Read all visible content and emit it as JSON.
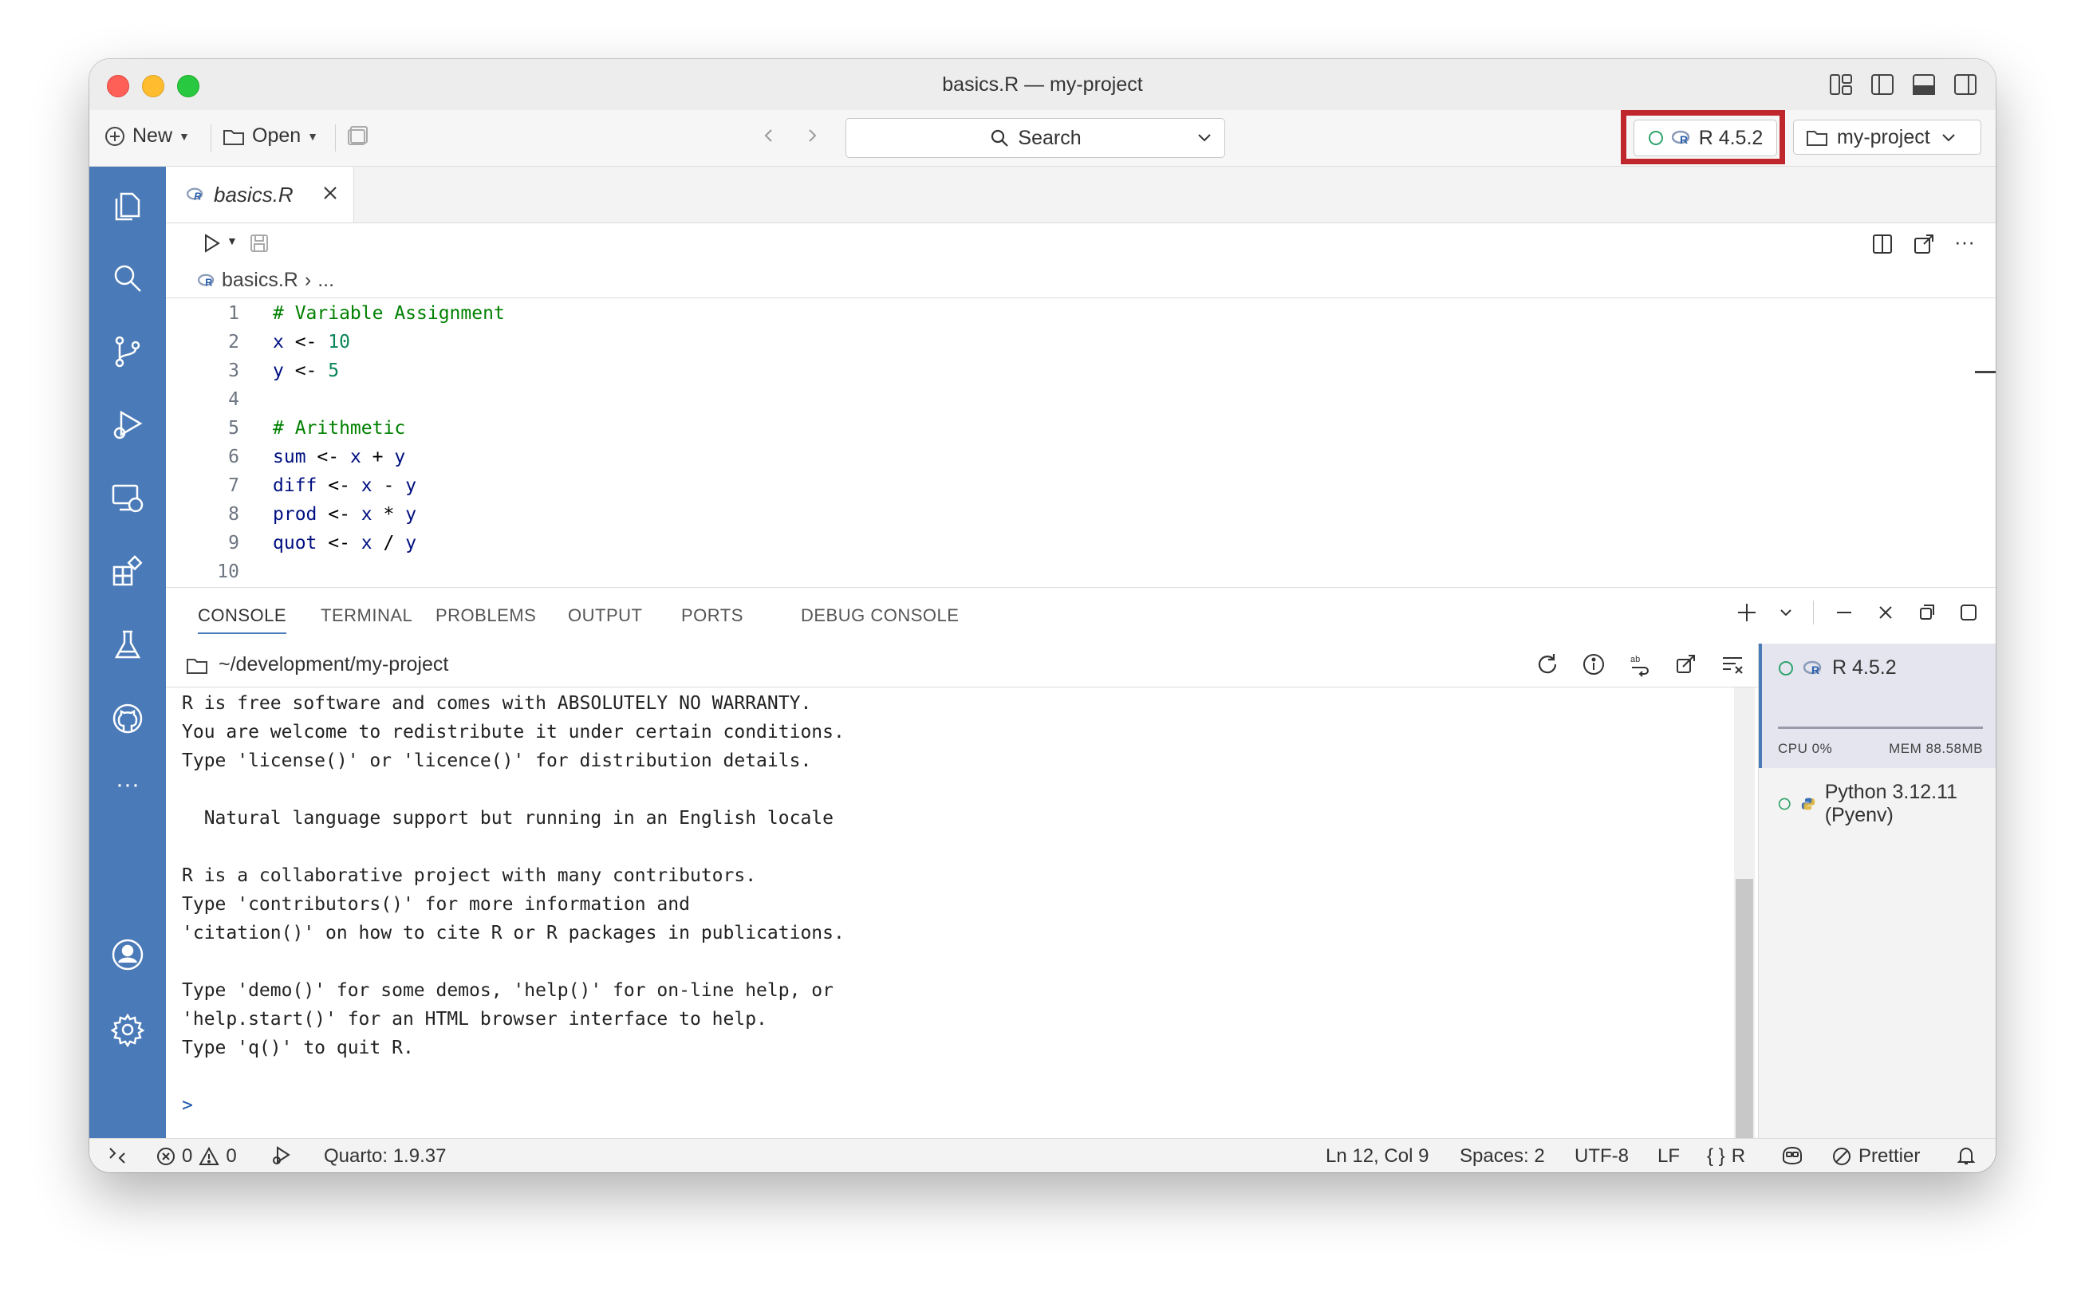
{
  "window": {
    "title": "basics.R — my-project"
  },
  "toolbar": {
    "new_label": "New",
    "open_label": "Open",
    "search_label": "Search",
    "interpreter_label": "R 4.5.2",
    "project_label": "my-project"
  },
  "editor": {
    "tab_label": "basics.R",
    "breadcrumb_file": "basics.R",
    "breadcrumb_more": "...",
    "lines": [
      {
        "n": "1",
        "tokens": [
          {
            "t": "# Variable Assignment",
            "c": "c-com"
          }
        ]
      },
      {
        "n": "2",
        "tokens": [
          {
            "t": "x",
            "c": "c-id"
          },
          {
            "t": " <- ",
            "c": "c-op"
          },
          {
            "t": "10",
            "c": "c-num"
          }
        ]
      },
      {
        "n": "3",
        "tokens": [
          {
            "t": "y",
            "c": "c-id"
          },
          {
            "t": " <- ",
            "c": "c-op"
          },
          {
            "t": "5",
            "c": "c-num"
          }
        ]
      },
      {
        "n": "4",
        "tokens": []
      },
      {
        "n": "5",
        "tokens": [
          {
            "t": "# Arithmetic",
            "c": "c-com"
          }
        ]
      },
      {
        "n": "6",
        "tokens": [
          {
            "t": "sum",
            "c": "c-id"
          },
          {
            "t": " <- ",
            "c": "c-op"
          },
          {
            "t": "x",
            "c": "c-id"
          },
          {
            "t": " + ",
            "c": "c-op"
          },
          {
            "t": "y",
            "c": "c-id"
          }
        ]
      },
      {
        "n": "7",
        "tokens": [
          {
            "t": "diff",
            "c": "c-id"
          },
          {
            "t": " <- ",
            "c": "c-op"
          },
          {
            "t": "x",
            "c": "c-id"
          },
          {
            "t": " - ",
            "c": "c-op"
          },
          {
            "t": "y",
            "c": "c-id"
          }
        ]
      },
      {
        "n": "8",
        "tokens": [
          {
            "t": "prod",
            "c": "c-id"
          },
          {
            "t": " <- ",
            "c": "c-op"
          },
          {
            "t": "x",
            "c": "c-id"
          },
          {
            "t": " * ",
            "c": "c-op"
          },
          {
            "t": "y",
            "c": "c-id"
          }
        ]
      },
      {
        "n": "9",
        "tokens": [
          {
            "t": "quot",
            "c": "c-id"
          },
          {
            "t": " <- ",
            "c": "c-op"
          },
          {
            "t": "x",
            "c": "c-id"
          },
          {
            "t": " / ",
            "c": "c-op"
          },
          {
            "t": "y",
            "c": "c-id"
          }
        ]
      },
      {
        "n": "10",
        "tokens": []
      }
    ]
  },
  "panel": {
    "tabs": [
      "CONSOLE",
      "TERMINAL",
      "PROBLEMS",
      "OUTPUT",
      "PORTS",
      "DEBUG CONSOLE"
    ],
    "console_path": "~/development/my-project",
    "console_lines": [
      "R is free software and comes with ABSOLUTELY NO WARRANTY.",
      "You are welcome to redistribute it under certain conditions.",
      "Type 'license()' or 'licence()' for distribution details.",
      "",
      "  Natural language support but running in an English locale",
      "",
      "R is a collaborative project with many contributors.",
      "Type 'contributors()' for more information and",
      "'citation()' on how to cite R or R packages in publications.",
      "",
      "Type 'demo()' for some demos, 'help()' for on-line help, or",
      "'help.start()' for an HTML browser interface to help.",
      "Type 'q()' to quit R.",
      ""
    ],
    "prompt": ">"
  },
  "sessions": {
    "r_label": "R 4.5.2",
    "cpu": "CPU 0%",
    "mem": "MEM 88.58MB",
    "python_label": "Python 3.12.11 (Pyenv)"
  },
  "statusbar": {
    "errors": "0",
    "warnings": "0",
    "quarto": "Quarto: 1.9.37",
    "position": "Ln 12, Col 9",
    "spaces": "Spaces: 2",
    "encoding": "UTF-8",
    "eol": "LF",
    "language": "R",
    "prettier": "Prettier"
  },
  "colors": {
    "accent": "#4a7ab8",
    "highlight": "#c0272d",
    "status_ok": "#2fa36b"
  }
}
